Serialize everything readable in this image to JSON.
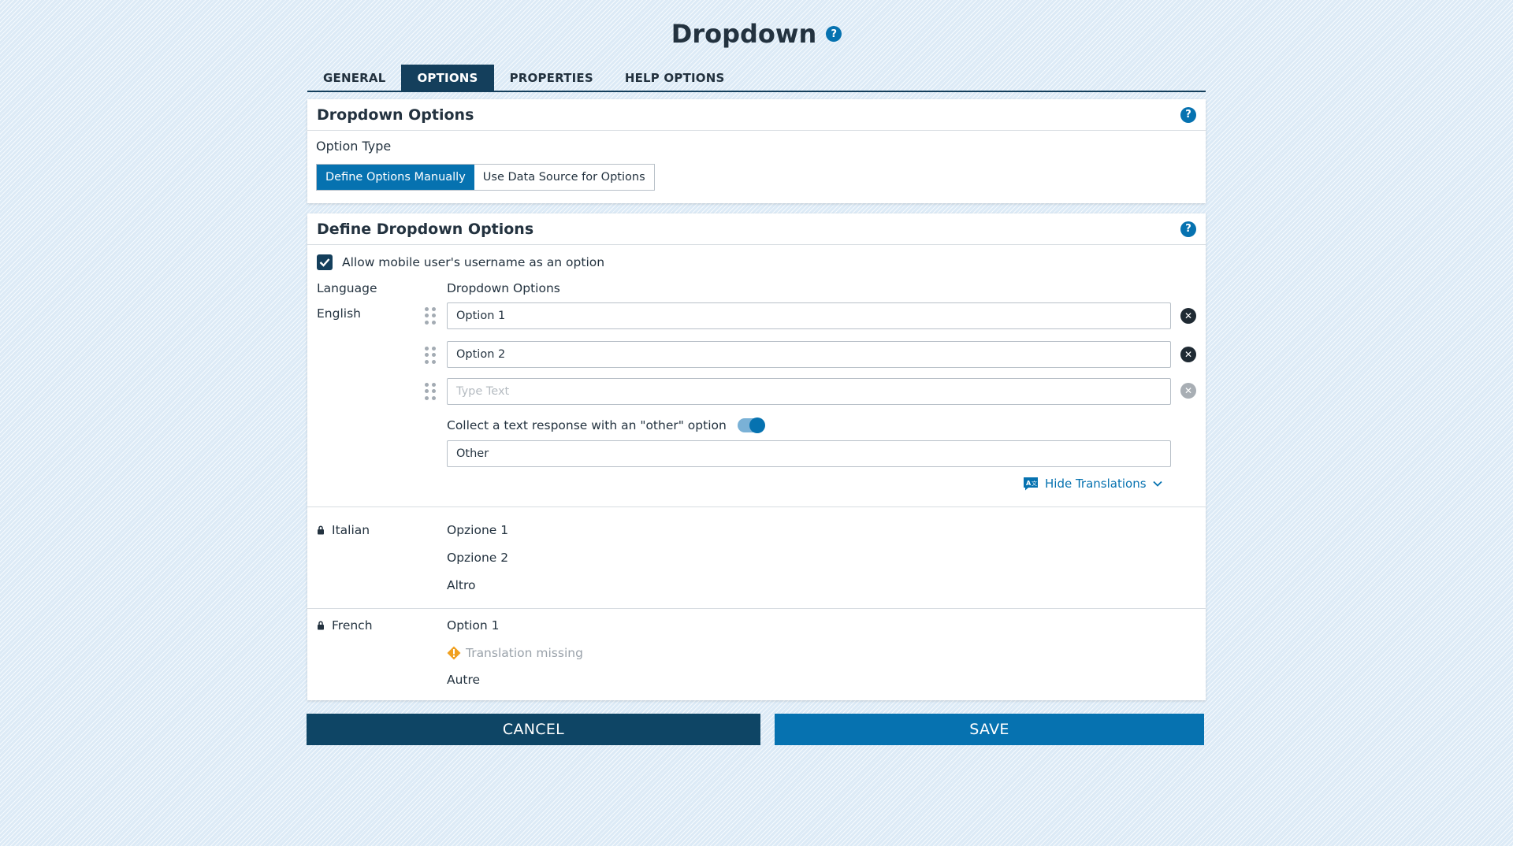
{
  "header": {
    "title": "Dropdown",
    "help": "?"
  },
  "tabs": [
    {
      "label": "GENERAL",
      "active": false
    },
    {
      "label": "OPTIONS",
      "active": true
    },
    {
      "label": "PROPERTIES",
      "active": false
    },
    {
      "label": "HELP OPTIONS",
      "active": false
    }
  ],
  "dropdown_options_card": {
    "title": "Dropdown Options",
    "option_type_label": "Option Type",
    "option_type_buttons": [
      "Define Options Manually",
      "Use Data Source for Options"
    ],
    "selected": "Define Options Manually"
  },
  "define_card": {
    "title": "Define Dropdown Options",
    "allow_username_label": "Allow mobile user's username as an option",
    "allow_username_checked": true,
    "language_header": "Language",
    "options_header": "Dropdown Options",
    "english": {
      "label": "English",
      "options": [
        "Option 1",
        "Option 2"
      ],
      "new_option_placeholder": "Type Text"
    },
    "other_toggle_label": "Collect a text response with an \"other\" option",
    "other_toggle_on": true,
    "other_value": "Other",
    "hide_translations": "Hide Translations",
    "italian": {
      "label": "Italian",
      "options": [
        "Opzione 1",
        "Opzione 2",
        "Altro"
      ]
    },
    "french": {
      "label": "French",
      "option_1": "Option 1",
      "missing": "Translation missing",
      "other": "Autre"
    }
  },
  "footer": {
    "cancel": "CANCEL",
    "save": "SAVE"
  },
  "colors": {
    "primary": "#0672b0",
    "dark": "#143f5c",
    "warning": "#f0a020"
  },
  "icons": [
    "help-icon",
    "check-icon",
    "drag-handle-icon",
    "close-icon",
    "lock-icon",
    "translate-icon",
    "chevron-down-icon",
    "warning-icon"
  ]
}
